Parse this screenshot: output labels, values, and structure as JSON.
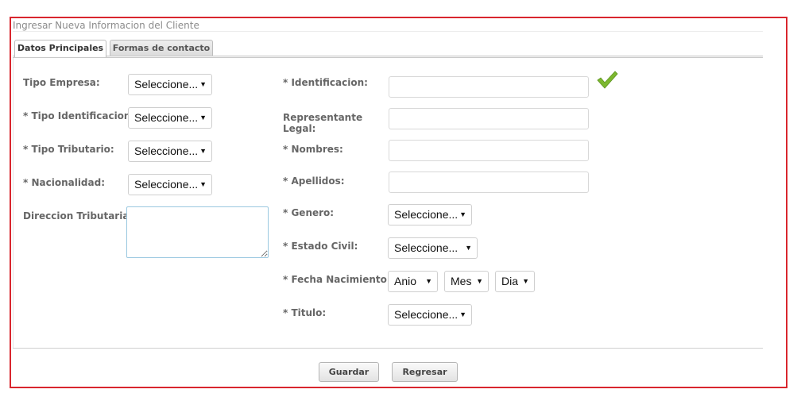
{
  "panel": {
    "title": "Ingresar Nueva Informacion del Cliente"
  },
  "tabs": [
    {
      "label": "Datos Principales",
      "active": true
    },
    {
      "label": "Formas de contacto",
      "active": false
    }
  ],
  "left_fields": {
    "tipo_empresa": {
      "label": "Tipo Empresa:",
      "value": "Seleccione..."
    },
    "tipo_identificacion": {
      "label": "* Tipo Identificacion:",
      "value": "Seleccione..."
    },
    "tipo_tributario": {
      "label": "* Tipo Tributario:",
      "value": "Seleccione..."
    },
    "nacionalidad": {
      "label": "* Nacionalidad:",
      "value": "Seleccione..."
    },
    "direccion_tributaria": {
      "label": "Direccion Tributaria:",
      "value": ""
    }
  },
  "right_fields": {
    "identificacion": {
      "label": "* Identificacion:",
      "value": "",
      "valid": true
    },
    "representante_legal": {
      "label_line1": "Representante",
      "label_line2": "Legal:",
      "value": ""
    },
    "nombres": {
      "label": "* Nombres:",
      "value": ""
    },
    "apellidos": {
      "label": "* Apellidos:",
      "value": ""
    },
    "genero": {
      "label": "* Genero:",
      "value": "Seleccione..."
    },
    "estado_civil": {
      "label": "* Estado Civil:",
      "value": "Seleccione..."
    },
    "fecha_nacimiento": {
      "label": "* Fecha Nacimiento:",
      "anio": "Anio",
      "mes": "Mes",
      "dia": "Dia"
    },
    "titulo": {
      "label": "* Titulo:",
      "value": "Seleccione..."
    }
  },
  "buttons": {
    "guardar": "Guardar",
    "regresar": "Regresar"
  },
  "icons": {
    "dropdown": "dropdown-arrow-icon",
    "valid": "checkmark-icon"
  },
  "colors": {
    "frame_border": "#d9262e",
    "checkmark": "#7cb82f",
    "textarea_focus": "#9ac8e0"
  }
}
